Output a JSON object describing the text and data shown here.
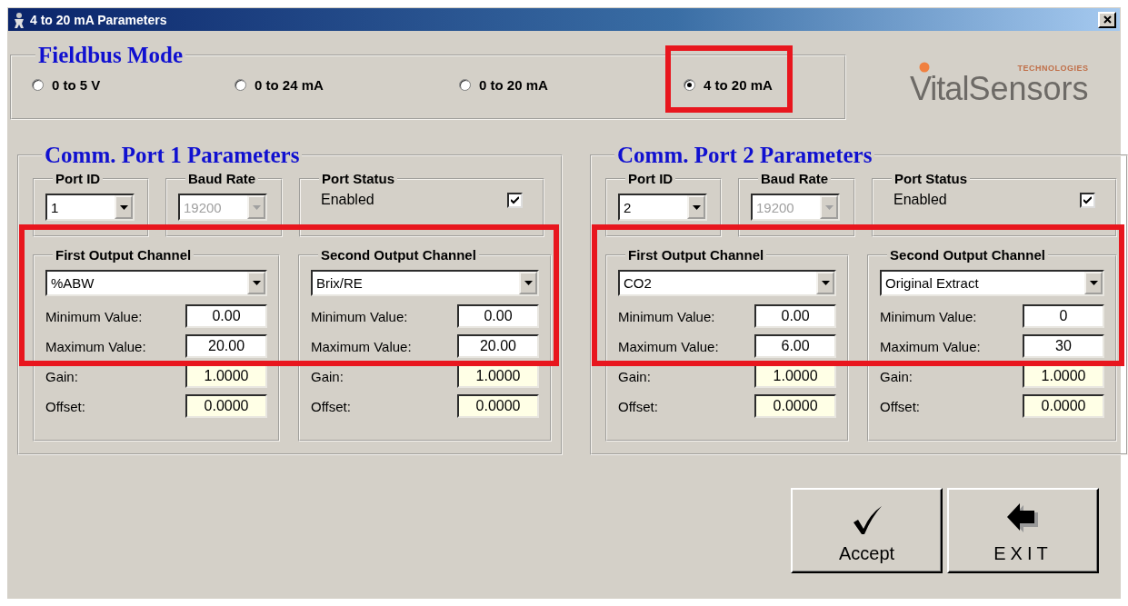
{
  "window": {
    "title": "4 to 20 mA Parameters"
  },
  "fieldbus_mode": {
    "title": "Fieldbus Mode",
    "options": [
      {
        "label": "0 to 5 V",
        "selected": false,
        "highlighted": false
      },
      {
        "label": "0 to 24 mA",
        "selected": false,
        "highlighted": false
      },
      {
        "label": "0 to 20 mA",
        "selected": false,
        "highlighted": false
      },
      {
        "label": "4 to 20 mA",
        "selected": true,
        "highlighted": true
      }
    ]
  },
  "logo": {
    "brand_part_1": "Vital",
    "brand_part_2": "Sensors",
    "tagline": "TECHNOLOGIES"
  },
  "ports": [
    {
      "title": "Comm. Port 1 Parameters",
      "port_id": {
        "label": "Port ID",
        "value": "1",
        "disabled": false
      },
      "baud_rate": {
        "label": "Baud Rate",
        "value": "19200",
        "disabled": true
      },
      "port_status": {
        "label": "Port Status",
        "checkbox_label": "Enabled",
        "checked": true
      },
      "channels_highlighted": true,
      "channels": [
        {
          "title": "First Output Channel",
          "selection": "%ABW",
          "fields": [
            {
              "label": "Minimum Value:",
              "value": "0.00",
              "readonly": false
            },
            {
              "label": "Maximum Value:",
              "value": "20.00",
              "readonly": false
            },
            {
              "label": "Gain:",
              "value": "1.0000",
              "readonly": true
            },
            {
              "label": "Offset:",
              "value": "0.0000",
              "readonly": true
            }
          ]
        },
        {
          "title": "Second Output Channel",
          "selection": "Brix/RE",
          "fields": [
            {
              "label": "Minimum Value:",
              "value": "0.00",
              "readonly": false
            },
            {
              "label": "Maximum Value:",
              "value": "20.00",
              "readonly": false
            },
            {
              "label": "Gain:",
              "value": "1.0000",
              "readonly": true
            },
            {
              "label": "Offset:",
              "value": "0.0000",
              "readonly": true
            }
          ]
        }
      ]
    },
    {
      "title": "Comm. Port 2 Parameters",
      "port_id": {
        "label": "Port ID",
        "value": "2",
        "disabled": false
      },
      "baud_rate": {
        "label": "Baud Rate",
        "value": "19200",
        "disabled": true
      },
      "port_status": {
        "label": "Port Status",
        "checkbox_label": "Enabled",
        "checked": true
      },
      "channels_highlighted": true,
      "channels": [
        {
          "title": "First Output Channel",
          "selection": "CO2",
          "fields": [
            {
              "label": "Minimum Value:",
              "value": "0.00",
              "readonly": false
            },
            {
              "label": "Maximum Value:",
              "value": "6.00",
              "readonly": false
            },
            {
              "label": "Gain:",
              "value": "1.0000",
              "readonly": true
            },
            {
              "label": "Offset:",
              "value": "0.0000",
              "readonly": true
            }
          ]
        },
        {
          "title": "Second Output Channel",
          "selection": "Original Extract",
          "fields": [
            {
              "label": "Minimum Value:",
              "value": "0",
              "readonly": false
            },
            {
              "label": "Maximum Value:",
              "value": "30",
              "readonly": false
            },
            {
              "label": "Gain:",
              "value": "1.0000",
              "readonly": true
            },
            {
              "label": "Offset:",
              "value": "0.0000",
              "readonly": true
            }
          ]
        }
      ]
    }
  ],
  "buttons": [
    {
      "kind": "accept",
      "label": "Accept"
    },
    {
      "kind": "exit",
      "label": "EXIT"
    }
  ]
}
